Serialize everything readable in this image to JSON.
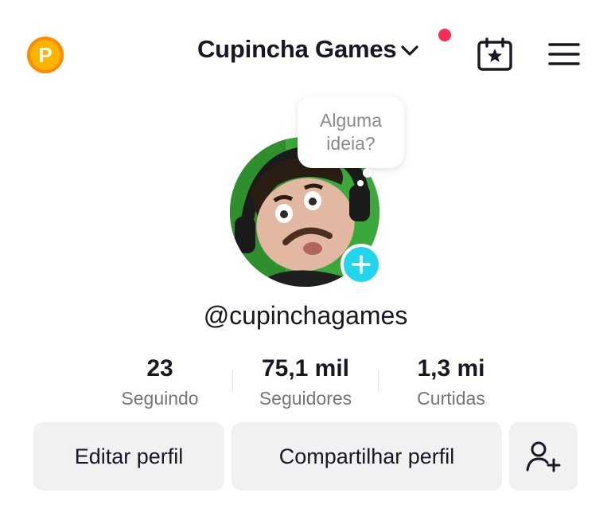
{
  "header": {
    "coin_letter": "P",
    "title": "Cupincha Games",
    "notification_color": "#fe2c55"
  },
  "avatar": {
    "prompt_bubble": "Alguma ideia?",
    "add_badge_color": "#20d5ec"
  },
  "profile": {
    "username": "@cupinchagames"
  },
  "stats": [
    {
      "value": "23",
      "label": "Seguindo"
    },
    {
      "value": "75,1 mil",
      "label": "Seguidores"
    },
    {
      "value": "1,3 mi",
      "label": "Curtidas"
    }
  ],
  "actions": {
    "edit_label": "Editar perfil",
    "share_label": "Compartilhar perfil",
    "add_friend_icon": "person-add-icon"
  },
  "icons": {
    "coin": "coin-icon",
    "chevron": "chevron-down-icon",
    "calendar": "calendar-star-icon",
    "menu": "hamburger-menu-icon",
    "add": "plus-icon"
  }
}
